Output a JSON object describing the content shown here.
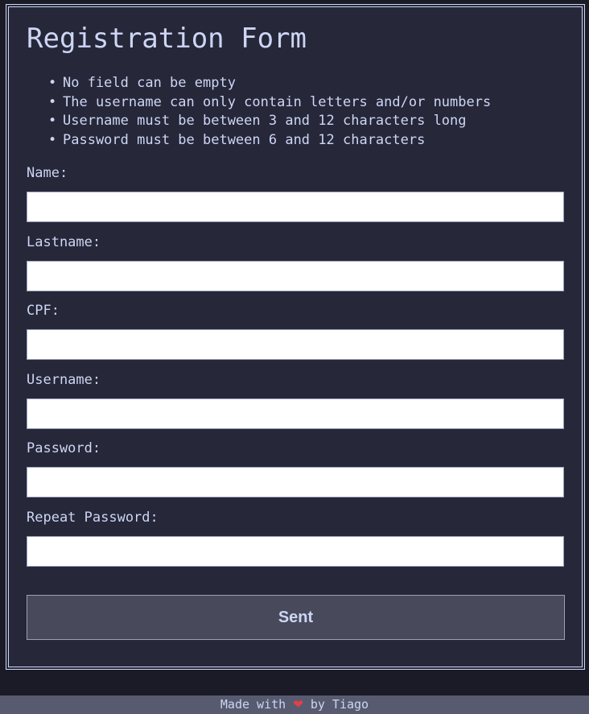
{
  "form": {
    "title": "Registration Form",
    "rules": [
      "No field can be empty",
      "The username can only contain letters and/or numbers",
      "Username must be between 3 and 12 characters long",
      "Password must be between 6 and 12 characters"
    ],
    "fields": [
      {
        "label": "Name:",
        "value": ""
      },
      {
        "label": "Lastname:",
        "value": ""
      },
      {
        "label": "CPF:",
        "value": ""
      },
      {
        "label": "Username:",
        "value": ""
      },
      {
        "label": "Password:",
        "value": ""
      },
      {
        "label": "Repeat Password:",
        "value": ""
      }
    ],
    "submit_label": "Sent"
  },
  "footer": {
    "prefix": "Made with",
    "icon": "heart-icon",
    "icon_color": "#e0404b",
    "suffix": "by Tiago"
  },
  "colors": {
    "background": "#1b1b27",
    "card": "#262739",
    "text": "#cdd6f4",
    "button": "#484a5c",
    "footer": "#585b70"
  }
}
